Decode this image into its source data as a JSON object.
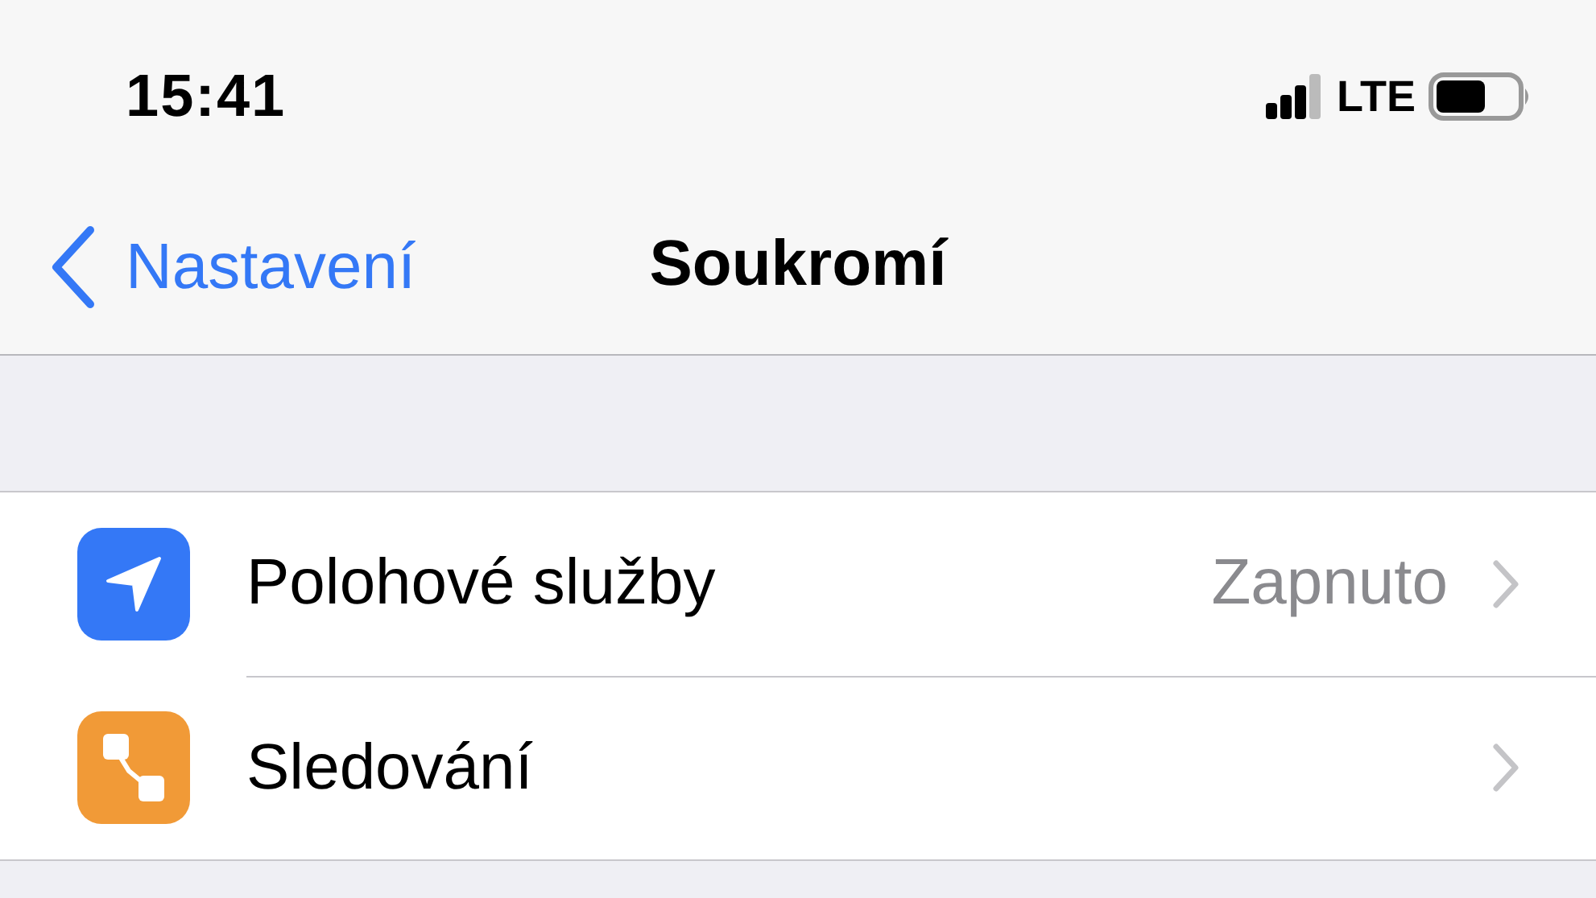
{
  "status_bar": {
    "time": "15:41",
    "network": "LTE"
  },
  "nav_bar": {
    "back": "Nastavení",
    "title": "Soukromí"
  },
  "rows": [
    {
      "kind": "location",
      "label": "Polohové služby",
      "value": "Zapnuto"
    },
    {
      "kind": "tracking",
      "label": "Sledování"
    }
  ]
}
